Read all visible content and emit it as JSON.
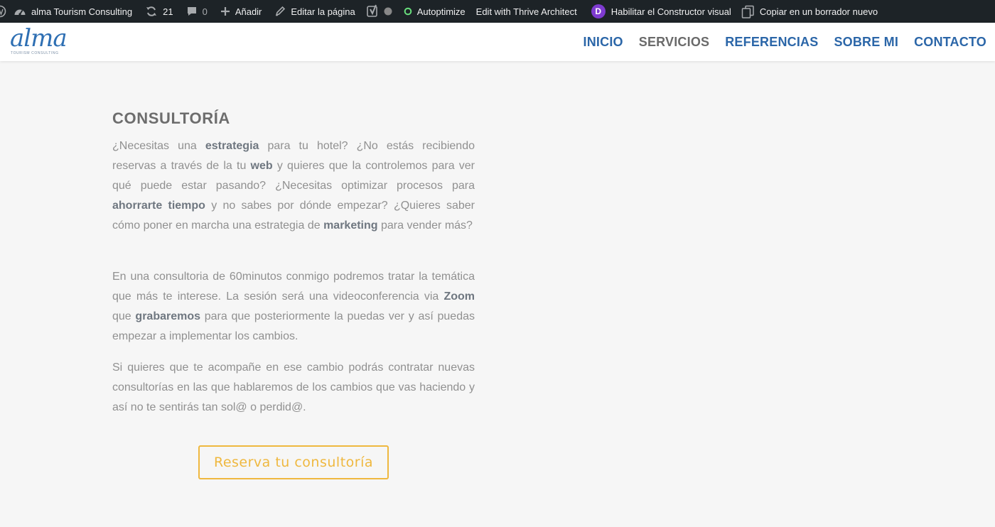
{
  "adminbar": {
    "site_name": "alma Tourism Consulting",
    "updates_count": "21",
    "comments_count": "0",
    "new_label": "Añadir",
    "edit_label": "Editar la página",
    "autoptimize_label": "Autoptimize",
    "thrive_label": "Edit with Thrive Architect",
    "divi_badge": "D",
    "divi_label": "Habilitar el Constructor visual",
    "copy_label": "Copiar en un borrador nuevo",
    "colors": {
      "background": "#1d2327",
      "text": "#f0f0f1",
      "icon": "#a7aaad",
      "status_green": "#68de7c",
      "divi_purple": "#7e3bd0"
    }
  },
  "header": {
    "logo_word": "alma",
    "logo_sub": "TOURISM CONSULTING",
    "nav": [
      {
        "label": "INICIO",
        "active": false
      },
      {
        "label": "SERVICIOS",
        "active": true
      },
      {
        "label": "REFERENCIAS",
        "active": false
      },
      {
        "label": "SOBRE MI",
        "active": false
      },
      {
        "label": "CONTACTO",
        "active": false
      }
    ],
    "colors": {
      "link": "#2b66a8",
      "active": "#6a6a6a",
      "logo": "#2e6fb3"
    }
  },
  "main": {
    "title": "CONSULTORÍA",
    "paragraphs": [
      [
        {
          "t": "¿Necesitas una "
        },
        {
          "t": "estrategia",
          "b": true
        },
        {
          "t": " para tu hotel? ¿No estás recibiendo reservas a través de la tu "
        },
        {
          "t": "web",
          "b": true
        },
        {
          "t": " y quieres que la controlemos para ver qué puede estar pasando? ¿Necesitas optimizar procesos para "
        },
        {
          "t": "ahorrarte tiempo",
          "b": true
        },
        {
          "t": " y no sabes por dónde empezar? ¿Quieres saber cómo poner en marcha una estrategia de "
        },
        {
          "t": "marketing",
          "b": true
        },
        {
          "t": " para vender más?"
        }
      ],
      [
        {
          "t": "En una consultoria de 60minutos conmigo podremos tratar la temática que más te interese. La sesión será una videoconferencia via "
        },
        {
          "t": "Zoom",
          "b": true
        },
        {
          "t": " que "
        },
        {
          "t": "grabaremos",
          "b": true
        },
        {
          "t": " para que posteriormente la puedas ver y así puedas empezar a implementar los cambios."
        }
      ],
      [
        {
          "t": "Si quieres que te acompañe en ese cambio podrás contratar nuevas consultorías en las que hablaremos de los cambios que vas haciendo y así no te sentirás tan sol@ o perdid@."
        }
      ]
    ],
    "cta_label": "Reserva tu consultoría",
    "colors": {
      "cta": "#efb83f",
      "text": "#909090",
      "bold": "#6f7780",
      "background": "#f6f6f6"
    }
  }
}
